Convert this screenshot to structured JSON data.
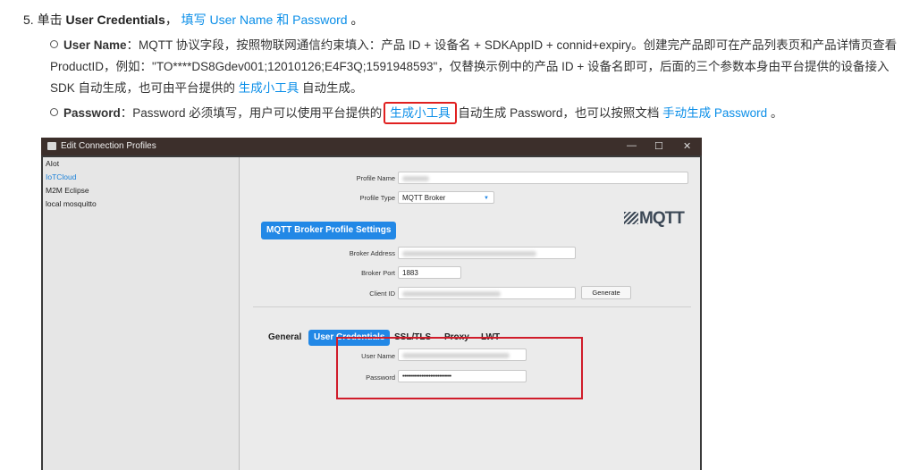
{
  "step": {
    "number": "5.",
    "prefix": "单击",
    "name": "User Credentials",
    "sep": "，",
    "link": "填写 User Name 和 Password",
    "end": "。"
  },
  "bullet1": {
    "label": "User Name",
    "text": "：MQTT 协议字段，按照物联网通信约束填入：产品 ID + 设备名 + SDKAppID + connid+expiry。创建完产品即可在产品列表页和产品详情页查看 ProductID，例如：\"TO****DS8Gdev001;12010126;E4F3Q;1591948593\"，仅替换示例中的产品 ID + 设备名即可，后面的三个参数本身由平台提供的设备接入 SDK 自动生成，也可由平台提供的",
    "link": "生成小工具",
    "tail": "自动生成。"
  },
  "bullet2": {
    "label": "Password",
    "text": "：Password 必须填写，用户可以使用平台提供的",
    "link": "生成小工具",
    "mid": "自动生成 Password，也可以按照文档",
    "link2": "手动生成 Password",
    "end": "。"
  },
  "window": {
    "title": "Edit Connection Profiles",
    "controls": [
      "—",
      "☐",
      "✕"
    ],
    "profiles": [
      "AIot",
      "IoTCloud",
      "M2M Eclipse",
      "local mosquitto"
    ],
    "selected_profile": "IoTCloud",
    "profile_name_label": "Profile Name",
    "profile_type_label": "Profile Type",
    "profile_type_value": "MQTT Broker",
    "logo_text": "MQTT",
    "section_button": "MQTT Broker Profile Settings",
    "broker_address_label": "Broker Address",
    "broker_port_label": "Broker Port",
    "broker_port_value": "1883",
    "client_id_label": "Client ID",
    "generate_button": "Generate",
    "tabs": [
      "General",
      "User Credentials",
      "SSL/TLS",
      "Proxy",
      "LWT"
    ],
    "active_tab": "User Credentials",
    "user_name_label": "User Name",
    "password_label": "Password",
    "password_value": "••••••••••••••••••••••••••••"
  },
  "colors": {
    "link": "#0a8ee8",
    "accent": "#2288e6",
    "highlight": "#e02020"
  }
}
